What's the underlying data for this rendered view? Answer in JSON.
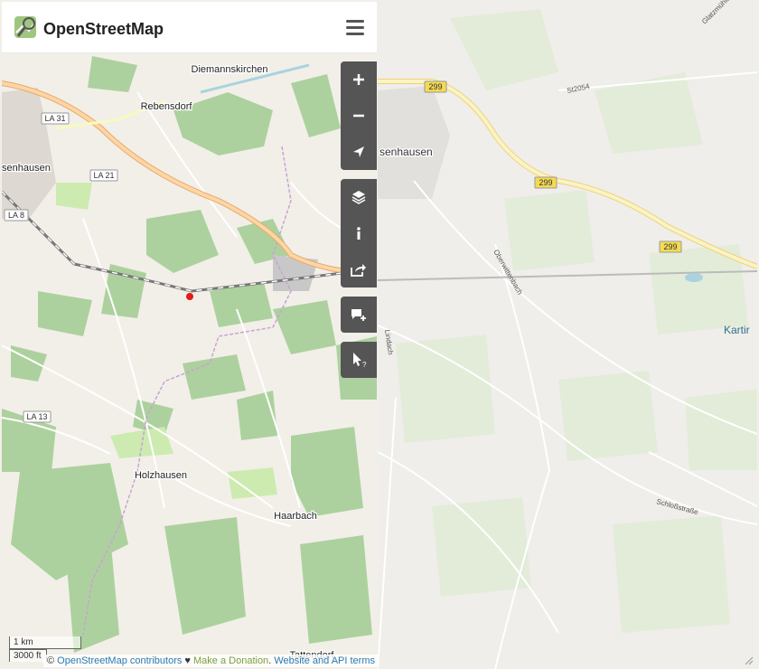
{
  "header": {
    "brand": "OpenStreetMap"
  },
  "left_map": {
    "places": {
      "diemannskirchen": "Diemannskirchen",
      "rebensdorf": "Rebensdorf",
      "senhausen": "senhausen",
      "holzhausen": "Holzhausen",
      "haarbach": "Haarbach",
      "tattendorf": "Tattendorf"
    },
    "roads": {
      "la31": "LA 31",
      "la21": "LA 21",
      "la8": "LA 8",
      "la13": "LA 13"
    }
  },
  "right_map": {
    "places": {
      "senhausen": "senhausen",
      "kartin": "Kartir",
      "glatzmuehle": "Glatzmühle"
    },
    "roads": {
      "b299_1": "299",
      "b299_2": "299",
      "b299_3": "299",
      "st2054": "St2054",
      "oberwittenbach": "Oberwittenbach",
      "lindach": "Lindach",
      "schlossstrasse": "Schloßstraße"
    }
  },
  "controls": {
    "zoom_in": "zoom-in",
    "zoom_out": "zoom-out",
    "locate": "locate",
    "layers": "layers",
    "info": "info",
    "share": "share",
    "note": "add-note",
    "query": "query-features"
  },
  "scale": {
    "metric": "1 km",
    "imperial": "3000 ft"
  },
  "attribution": {
    "copyright": "©",
    "contributors": "OpenStreetMap contributors",
    "heart": "♥",
    "donate": "Make a Donation",
    "sep": ".",
    "api": "Website and API terms"
  },
  "colors": {
    "land": "#f2efe9",
    "forest": "#add19e",
    "meadow": "#cdebb0",
    "primary_road": "#fcd6a4",
    "trunk_road": "#f7fabf",
    "marker": "#e21b1b",
    "control_bg": "#555555"
  }
}
